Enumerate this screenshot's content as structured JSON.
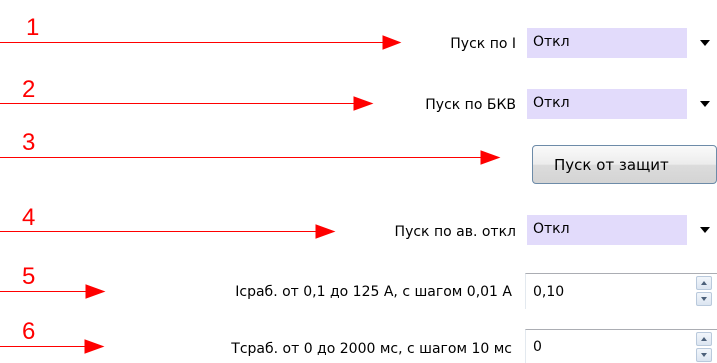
{
  "colors": {
    "annotation": "#ff0000",
    "combo_background": "#e2dbfb",
    "button_border": "#6d8ba8"
  },
  "annotations": [
    "1",
    "2",
    "3",
    "4",
    "5",
    "6"
  ],
  "rows": {
    "pusk_po_i": {
      "label": "Пуск по I",
      "value": "Откл"
    },
    "pusk_po_bkv": {
      "label": "Пуск по БКВ",
      "value": "Откл"
    },
    "pusk_ot_zashchit": {
      "button_label": "Пуск от защит"
    },
    "pusk_po_av_otkl": {
      "label": "Пуск по ав. откл",
      "value": "Откл"
    },
    "i_srab": {
      "label": "Iсраб. от 0,1 до 125 А, с шагом 0,01 А",
      "value": "0,10"
    },
    "t_srab": {
      "label": "Tсраб. от 0 до 2000 мс, с шагом 10 мс",
      "value": "0"
    }
  },
  "icons": {
    "dropdown": "chevron-down-icon",
    "spin_up": "spin-up-icon",
    "spin_down": "spin-down-icon"
  }
}
